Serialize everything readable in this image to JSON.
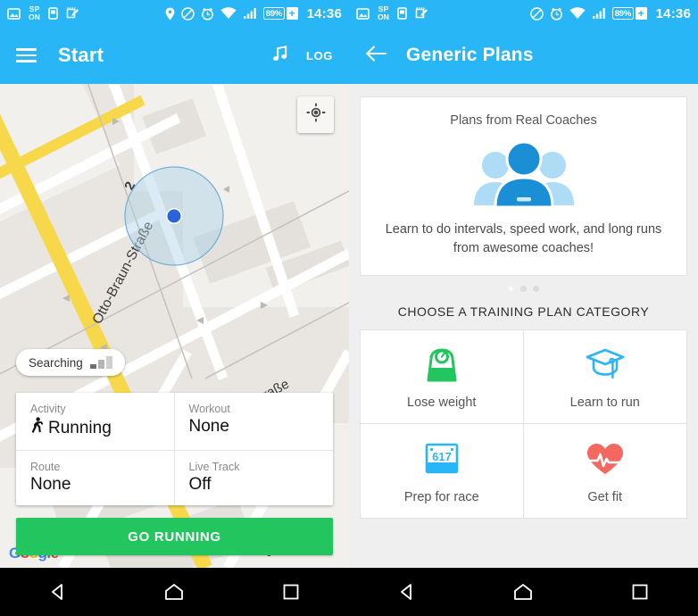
{
  "statusbar": {
    "icons_left": [
      "image-icon",
      "sp-on-indicator",
      "device-icon",
      "note-edit-icon"
    ],
    "sp_line1": "SP",
    "sp_line2": "ON",
    "icons_right": [
      "location-pin-icon",
      "do-not-disturb-icon",
      "alarm-icon",
      "wifi-icon",
      "signal-icon"
    ],
    "battery_percent": "89%",
    "battery_charging_glyph": "+",
    "time": "14:36"
  },
  "left_screen": {
    "appbar": {
      "menu_icon": "hamburger-icon",
      "title": "Start",
      "music_icon": "music-note-icon",
      "log_label": "LOG"
    },
    "map": {
      "street_1": "Otto-Braun-Straße",
      "street_2": "Mollstraße",
      "street_3": "straße",
      "route_shield": "2",
      "my_location_icon": "crosshair-icon",
      "attribution": "Google",
      "attribution_letters": [
        "G",
        "o",
        "o",
        "g",
        "l",
        "e"
      ]
    },
    "gps_chip": {
      "label": "Searching",
      "signal_icon": "signal-bars-icon"
    },
    "activity_card": {
      "rows": [
        {
          "key": "Activity",
          "value": "Running",
          "icon": "runner-icon"
        },
        {
          "key": "Workout",
          "value": "None",
          "icon": ""
        },
        {
          "key": "Route",
          "value": "None",
          "icon": ""
        },
        {
          "key": "Live Track",
          "value": "Off",
          "icon": ""
        }
      ]
    },
    "go_button": {
      "label": "GO RUNNING",
      "color": "#22C55E"
    }
  },
  "right_screen": {
    "appbar": {
      "back_icon": "back-arrow-icon",
      "title": "Generic Plans"
    },
    "promo": {
      "title": "Plans from Real Coaches",
      "art_icon": "coaches-group-icon",
      "body": "Learn to do intervals, speed work, and long runs from awesome coaches!",
      "dots_total": 3,
      "dots_active_index": 0
    },
    "section_title": "CHOOSE A TRAINING PLAN CATEGORY",
    "categories": [
      {
        "label": "Lose weight",
        "icon": "weight-scale-icon",
        "color": "#22C55E"
      },
      {
        "label": "Learn to run",
        "icon": "graduation-cap-icon",
        "color": "#29B6F6"
      },
      {
        "label": "Prep for race",
        "icon": "race-bib-icon",
        "color": "#29B6F6",
        "bib_number": "617"
      },
      {
        "label": "Get fit",
        "icon": "heart-pulse-icon",
        "color": "#F4685F"
      }
    ]
  },
  "navbar": {
    "back": "nav-back-icon",
    "home": "nav-home-icon",
    "recents": "nav-recents-icon"
  },
  "theme": {
    "primary": "#29B6F6",
    "green": "#22C55E",
    "red": "#F4685F",
    "bg": "#EFEFEF"
  }
}
